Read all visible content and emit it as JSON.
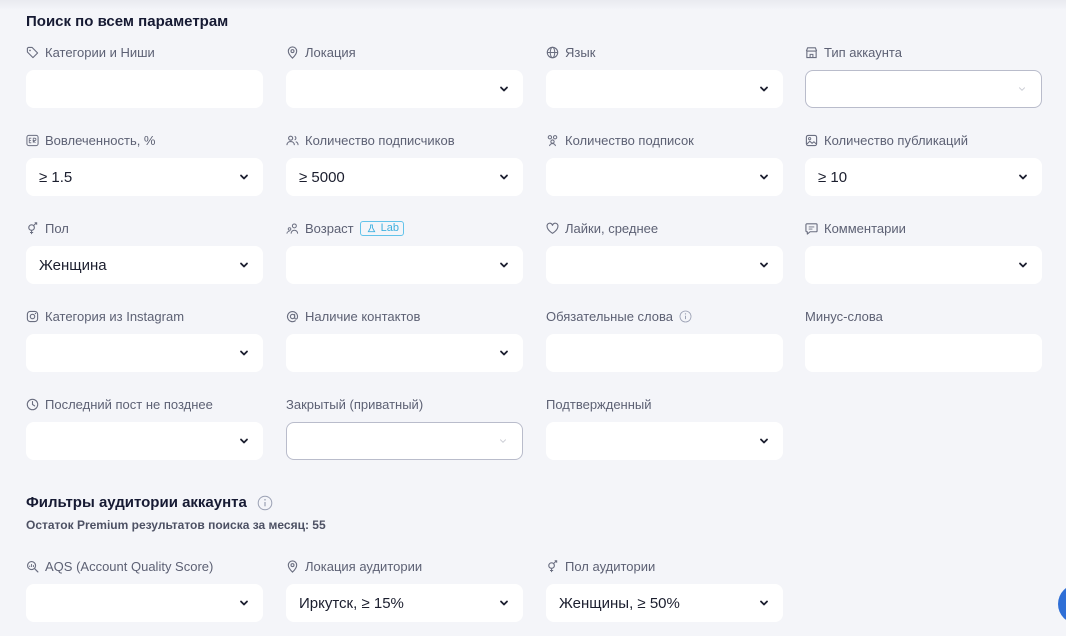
{
  "section": {
    "title": "Поиск по всем параметрам"
  },
  "fields": {
    "categories": {
      "label": "Категории и Ниши",
      "value": ""
    },
    "location": {
      "label": "Локация",
      "value": ""
    },
    "language": {
      "label": "Язык",
      "value": ""
    },
    "account_type": {
      "label": "Тип аккаунта",
      "value": ""
    },
    "engagement": {
      "label": "Вовлеченность, %",
      "value": "≥ 1.5"
    },
    "followers": {
      "label": "Количество подписчиков",
      "value": "≥ 5000"
    },
    "following": {
      "label": "Количество подписок",
      "value": ""
    },
    "posts": {
      "label": "Количество публикаций",
      "value": "≥ 10"
    },
    "gender": {
      "label": "Пол",
      "value": "Женщина"
    },
    "age": {
      "label": "Возраст",
      "badge": "Lab",
      "value": ""
    },
    "likes": {
      "label": "Лайки, среднее",
      "value": ""
    },
    "comments": {
      "label": "Комментарии",
      "value": ""
    },
    "ig_category": {
      "label": "Категория из Instagram",
      "value": ""
    },
    "contacts": {
      "label": "Наличие контактов",
      "value": ""
    },
    "required_words": {
      "label": "Обязательные слова",
      "value": ""
    },
    "minus_words": {
      "label": "Минус-слова",
      "value": ""
    },
    "last_post": {
      "label": "Последний пост не позднее",
      "value": ""
    },
    "private": {
      "label": "Закрытый (приватный)",
      "value": ""
    },
    "verified": {
      "label": "Подтвержденный",
      "value": ""
    }
  },
  "audience": {
    "title": "Фильтры аудитории аккаунта",
    "subtitle": "Остаток Premium результатов поиска за месяц: 55",
    "aqs": {
      "label": "AQS (Account Quality Score)",
      "value": ""
    },
    "location": {
      "label": "Локация аудитории",
      "value": "Иркутск, ≥ 15%"
    },
    "gender": {
      "label": "Пол аудитории",
      "value": "Женщины, ≥ 50%"
    }
  },
  "colors": {
    "background": "#f4f5f9",
    "field": "#ffffff",
    "label": "#5d6174",
    "badge": "#3fb0df",
    "fab": "#2f6fd6"
  }
}
